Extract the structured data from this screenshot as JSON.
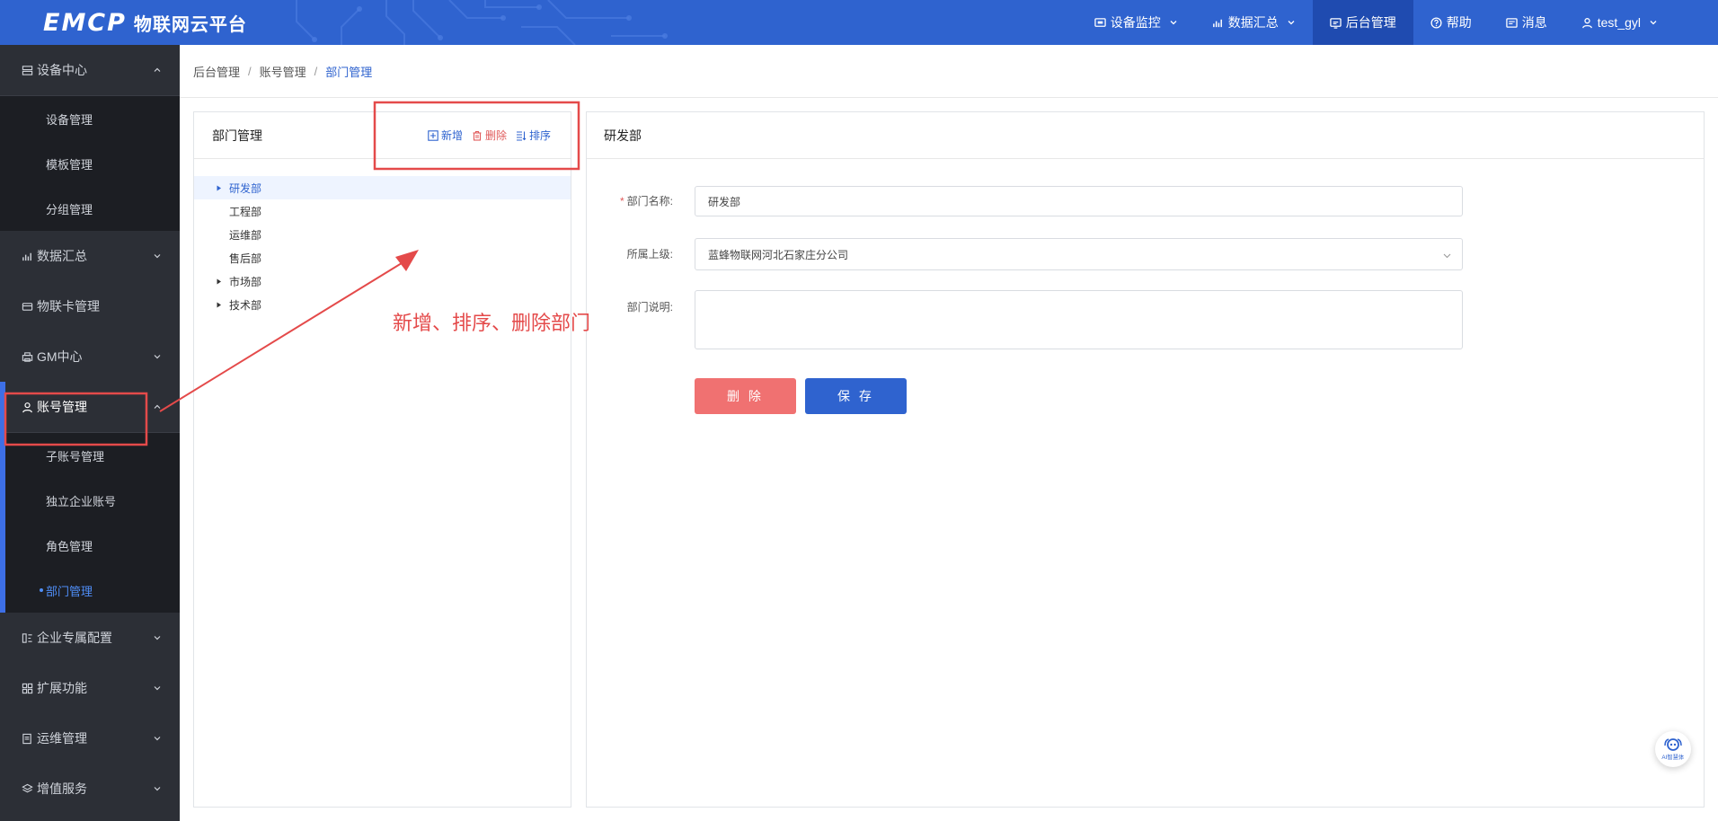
{
  "app": {
    "logo_mark": "EMCP",
    "logo_text": "物联网云平台"
  },
  "topnav": {
    "items": [
      {
        "label": "设备监控",
        "icon": "monitor-icon",
        "dropdown": true
      },
      {
        "label": "数据汇总",
        "icon": "bar-chart-icon",
        "dropdown": true
      },
      {
        "label": "后台管理",
        "icon": "admin-icon",
        "dropdown": false,
        "active": true
      },
      {
        "label": "帮助",
        "icon": "help-icon",
        "dropdown": false
      },
      {
        "label": "消息",
        "icon": "message-icon",
        "dropdown": false
      },
      {
        "label": "test_gyl",
        "icon": "user-icon",
        "dropdown": true
      }
    ]
  },
  "sidebar": {
    "device_center": {
      "label": "设备中心",
      "items": [
        "设备管理",
        "模板管理",
        "分组管理"
      ]
    },
    "data_summary": "数据汇总",
    "iot_card": "物联卡管理",
    "gm_center": "GM中心",
    "account": {
      "label": "账号管理",
      "items": [
        "子账号管理",
        "独立企业账号",
        "角色管理",
        "部门管理"
      ]
    },
    "enterprise": "企业专属配置",
    "extension": "扩展功能",
    "ops": "运维管理",
    "value_added": "增值服务"
  },
  "breadcrumb": {
    "items": [
      "后台管理",
      "账号管理",
      "部门管理"
    ],
    "separator": "/"
  },
  "dept_panel": {
    "title": "部门管理",
    "add_label": "新增",
    "delete_label": "删除",
    "sort_label": "排序",
    "tree": [
      {
        "label": "研发部",
        "expandable": true,
        "selected": true
      },
      {
        "label": "工程部",
        "expandable": false
      },
      {
        "label": "运维部",
        "expandable": false
      },
      {
        "label": "售后部",
        "expandable": false
      },
      {
        "label": "市场部",
        "expandable": true
      },
      {
        "label": "技术部",
        "expandable": true
      }
    ]
  },
  "detail": {
    "title": "研发部",
    "name_label": "部门名称:",
    "name_required_mark": "*",
    "name_value": "研发部",
    "parent_label": "所属上级:",
    "parent_value": "蓝蜂物联网河北石家庄分公司",
    "desc_label": "部门说明:",
    "desc_value": "",
    "delete_button": "删 除",
    "save_button": "保 存"
  },
  "annotation": {
    "text": "新增、排序、删除部门",
    "color": "#e44a4a"
  },
  "ai_assistant": {
    "label": "AI智慧体"
  },
  "colors": {
    "primary": "#2f63cf",
    "danger": "#f07171",
    "sidebar_bg": "#2c2f36"
  }
}
